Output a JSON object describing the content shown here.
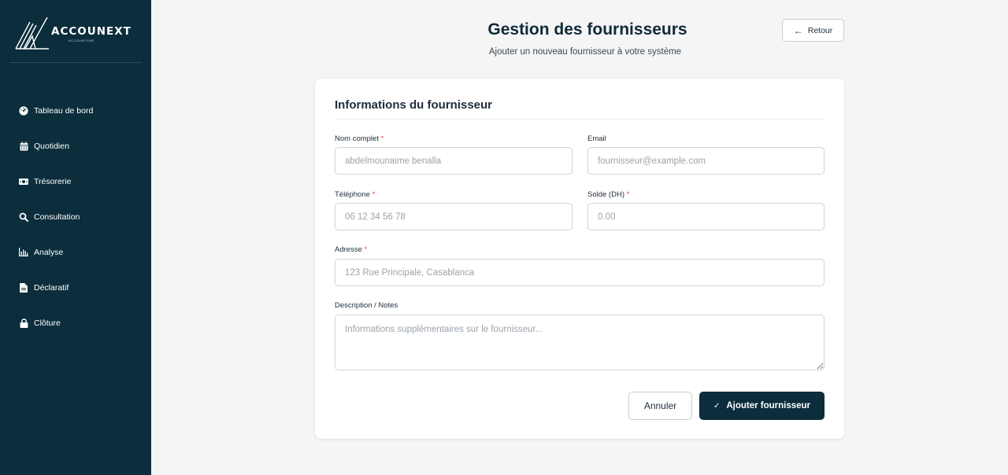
{
  "brand": {
    "name": "ACCOUNEXT",
    "tagline": "ACCOUNTING"
  },
  "sidebar": {
    "items": [
      {
        "label": "Tableau de bord",
        "icon": "dashboard-gauge-icon"
      },
      {
        "label": "Quotidien",
        "icon": "calendar-icon"
      },
      {
        "label": "Trésorerie",
        "icon": "money-bill-icon"
      },
      {
        "label": "Consultation",
        "icon": "search-icon"
      },
      {
        "label": "Analyse",
        "icon": "bar-chart-icon"
      },
      {
        "label": "Déclaratif",
        "icon": "file-icon"
      },
      {
        "label": "Clôture",
        "icon": "lock-icon"
      }
    ]
  },
  "header": {
    "title": "Gestion des fournisseurs",
    "subtitle": "Ajouter un nouveau fournisseur à votre système",
    "back_label": "Retour"
  },
  "form": {
    "section_title": "Informations du fournisseur",
    "required_mark": "*",
    "fields": {
      "nom": {
        "label": "Nom complet",
        "placeholder": "abdelmounaime benalla",
        "value": ""
      },
      "email": {
        "label": "Email",
        "placeholder": "fournisseur@example.com",
        "value": ""
      },
      "telephone": {
        "label": "Téléphone",
        "placeholder": "06 12 34 56 78",
        "value": ""
      },
      "solde": {
        "label": "Solde (DH)",
        "placeholder": "0.00",
        "value": ""
      },
      "adresse": {
        "label": "Adresse",
        "placeholder": "123 Rue Principale, Casablanca",
        "value": ""
      },
      "description": {
        "label": "Description / Notes",
        "placeholder": "Informations supplémentaires sur le fournisseur...",
        "value": ""
      }
    },
    "cancel_label": "Annuler",
    "submit_label": "Ajouter fournisseur"
  },
  "colors": {
    "sidebar_bg": "#0b2d3c",
    "primary": "#0b2d3c",
    "required": "#e04848",
    "page_bg": "#f5f5f6"
  }
}
